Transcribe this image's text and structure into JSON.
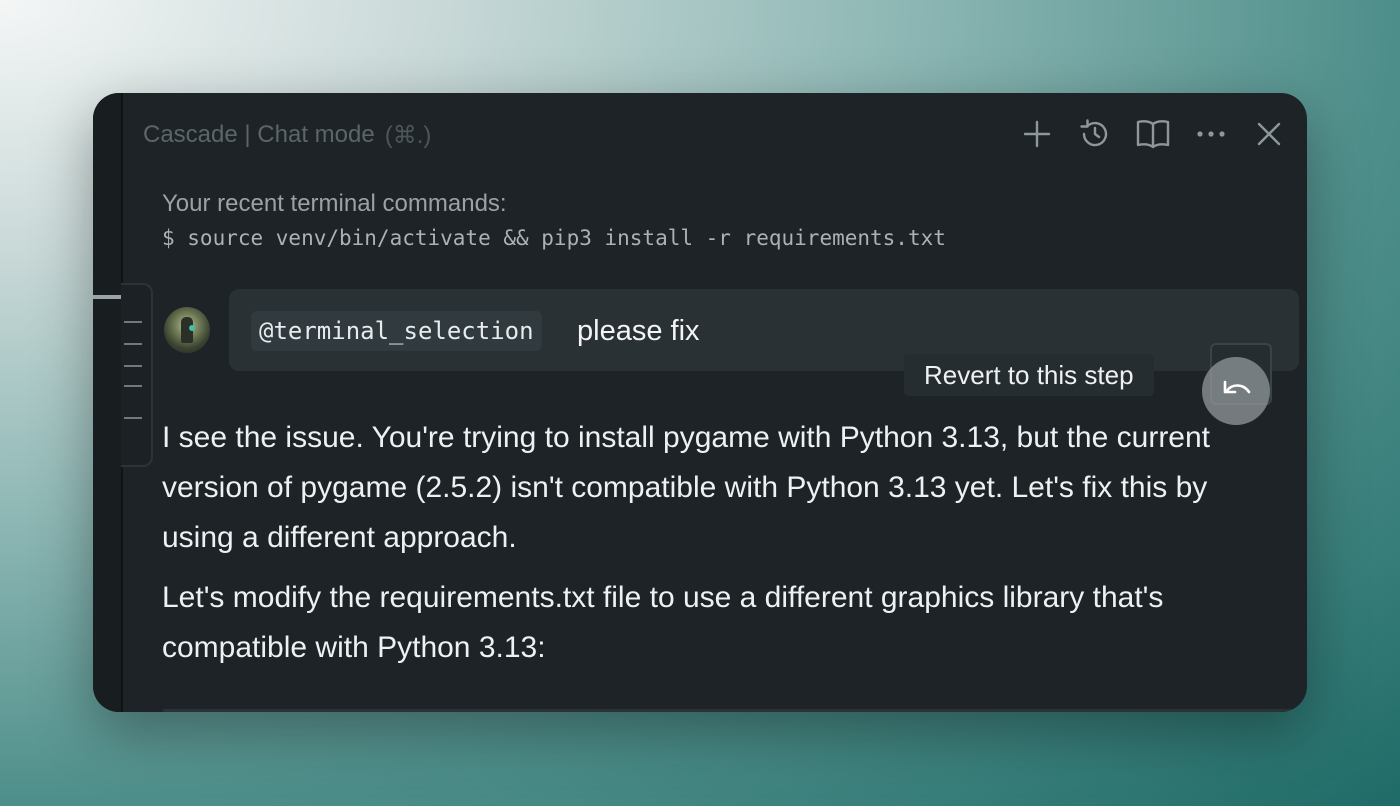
{
  "panel": {
    "title": "Cascade | Chat mode",
    "shortcut": "(⌘.)",
    "toolbar": [
      {
        "name": "new-chat",
        "icon": "plus-icon"
      },
      {
        "name": "history",
        "icon": "history-icon"
      },
      {
        "name": "docs",
        "icon": "book-icon"
      },
      {
        "name": "more",
        "icon": "more-icon"
      },
      {
        "name": "close",
        "icon": "close-icon"
      }
    ]
  },
  "terminal": {
    "heading": "Your recent terminal commands:",
    "command": "$ source venv/bin/activate && pip3 install -r requirements.txt"
  },
  "user_message": {
    "mention": "@terminal_selection",
    "text": "please fix"
  },
  "revert": {
    "tooltip": "Revert to this step",
    "icon": "undo-icon"
  },
  "response": {
    "paragraph1": "I see the issue. You're trying to install pygame with Python 3.13, but the current version of pygame (2.5.2) isn't compatible with Python 3.13 yet. Let's fix this by using a different approach.",
    "paragraph2": "Let's modify the requirements.txt file to use a different graphics library that's compatible with Python 3.13:"
  }
}
